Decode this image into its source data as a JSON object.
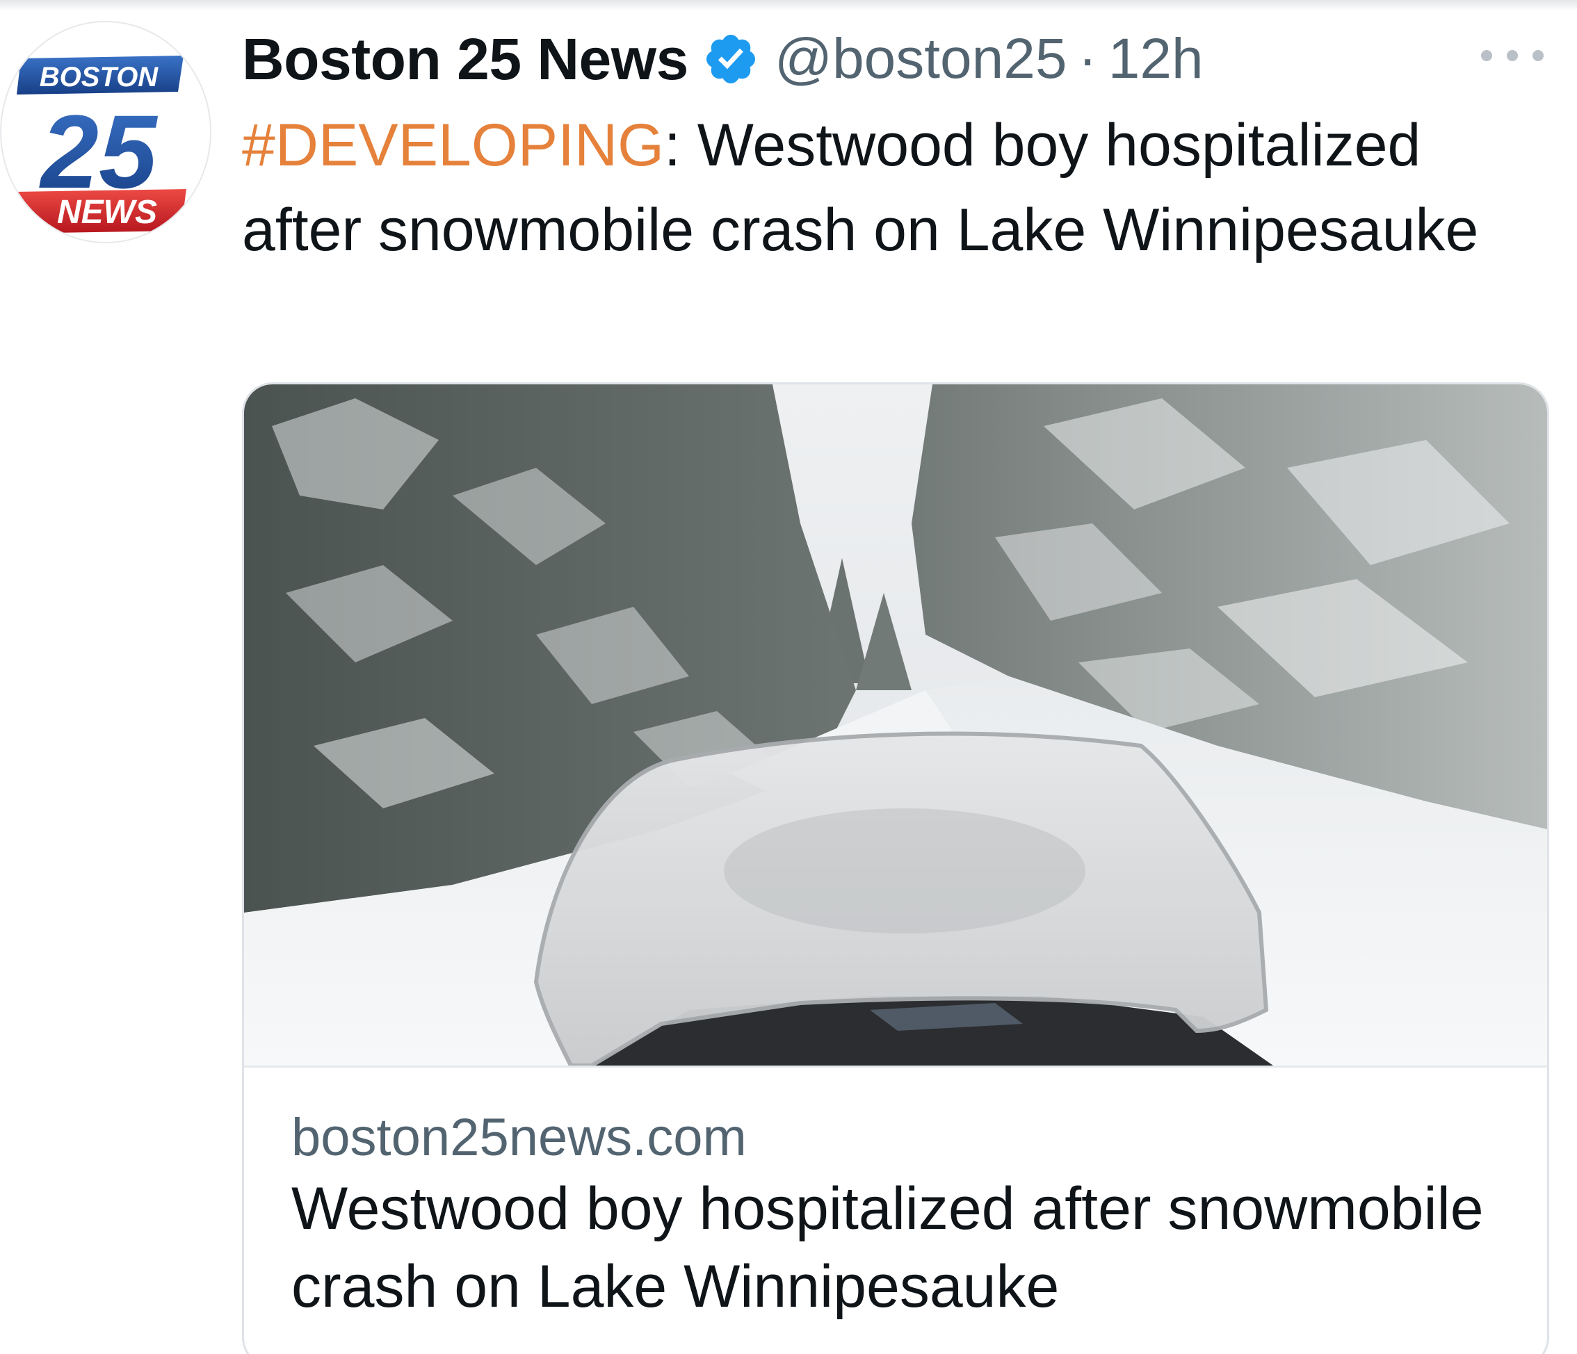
{
  "tweet": {
    "author": {
      "display_name": "Boston 25 News",
      "handle": "@boston25",
      "separator": "·",
      "time": "12h",
      "verified": true,
      "avatar_logo": {
        "line1": "BOSTON",
        "line2": "25",
        "line3": "NEWS",
        "colors": {
          "blue": "#1d4f9c",
          "red": "#d9232a"
        }
      }
    },
    "more_icon": "more-horizontal-icon",
    "text": {
      "hashtag": "#DEVELOPING",
      "colon": ":",
      "body": " Westwood boy hospitalized after snowmobile crash on Lake Winnipesauke"
    },
    "link_card": {
      "image_subject": "snowmobile windshield on a snowy forest trail",
      "domain": "boston25news.com",
      "title": "Westwood boy hospitalized after snowmobile crash on Lake Winnipesauke"
    }
  },
  "colors": {
    "text_primary": "#0f1419",
    "text_secondary": "#536471",
    "hashtag": "#e5813a",
    "verified": "#1d9bf0",
    "card_border": "#dfe3e7"
  }
}
